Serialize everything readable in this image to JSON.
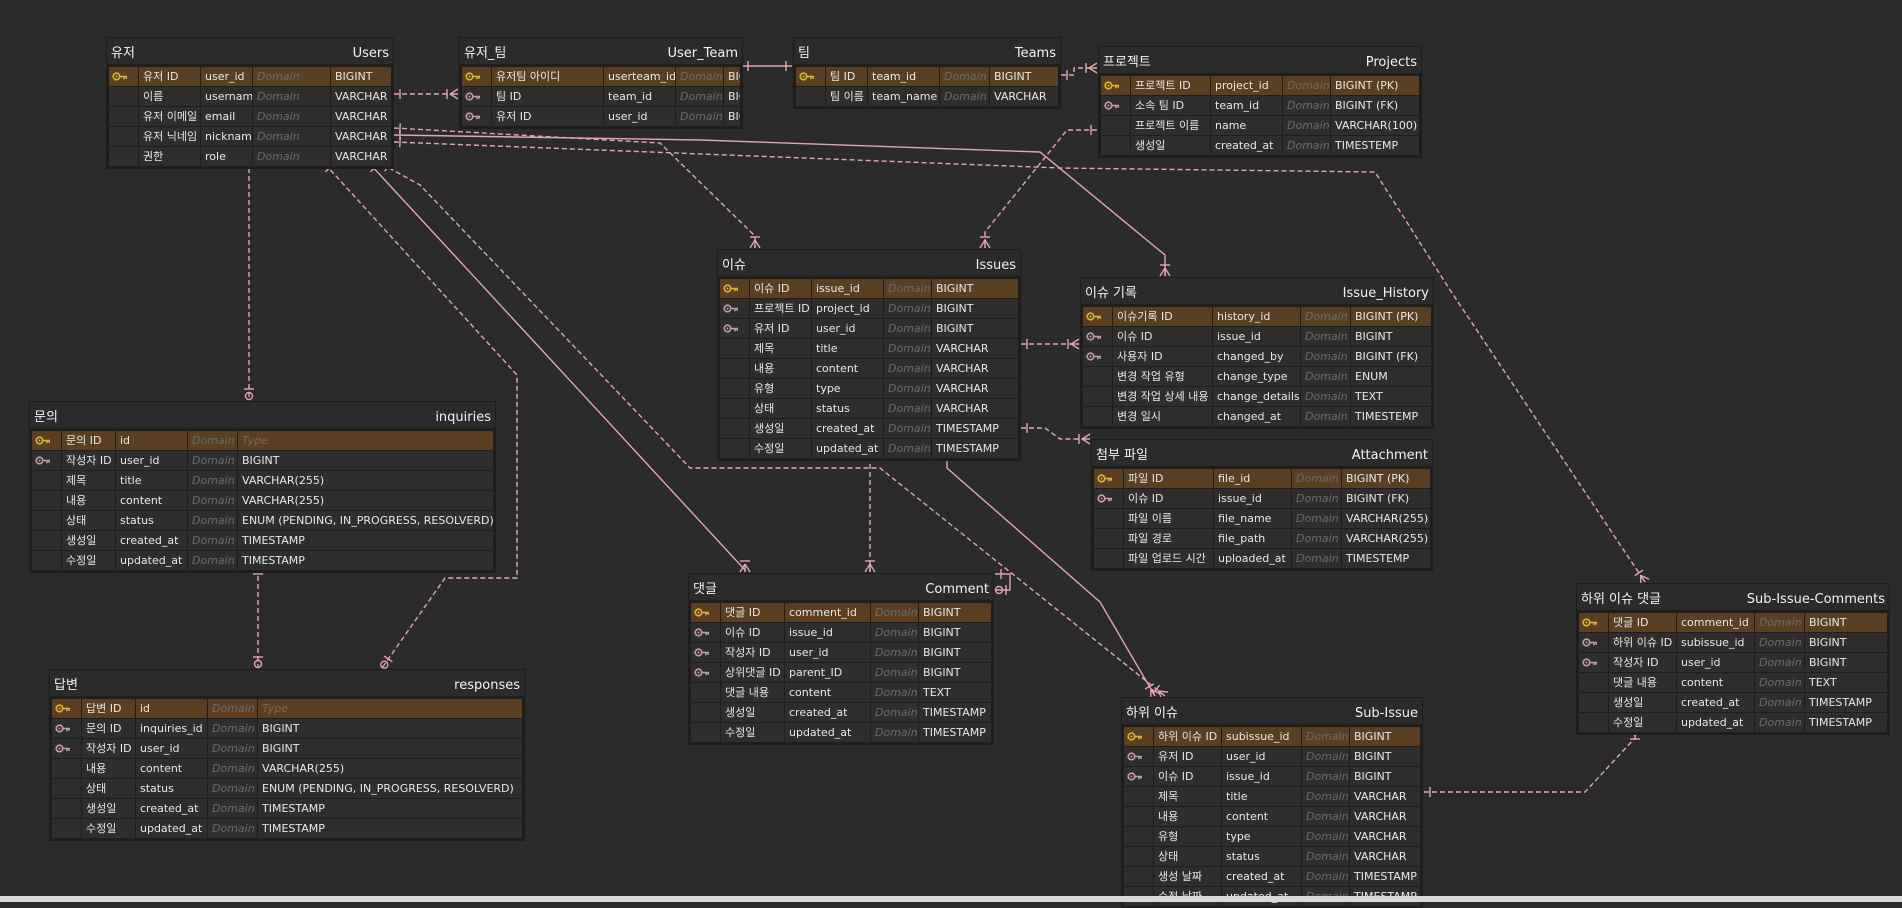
{
  "colors": {
    "background": "#2b2b2b",
    "row": "#2e2e2e",
    "pk_row": "#5a3f22",
    "link": "#e4a4b4",
    "pk_key": "#e0b437",
    "fk_key": "#c89aa6"
  },
  "domain_label": "Domain",
  "entities": [
    {
      "id": "users",
      "logical": "유저",
      "physical": "Users",
      "rows": [
        {
          "key": "pk",
          "name": "유저 ID",
          "column": "user_id",
          "type": "BIGINT"
        },
        {
          "key": "",
          "name": "이름",
          "column": "username",
          "type": "VARCHAR"
        },
        {
          "key": "",
          "name": "유저 이메일",
          "column": "email",
          "type": "VARCHAR"
        },
        {
          "key": "",
          "name": "유저 닉네임",
          "column": "nickname",
          "type": "VARCHAR"
        },
        {
          "key": "",
          "name": "권한",
          "column": " role",
          "type": "VARCHAR"
        }
      ]
    },
    {
      "id": "user_team",
      "logical": "유저_팀",
      "physical": "User_Team",
      "rows": [
        {
          "key": "pk",
          "name": "유저팀 아이디",
          "column": "userteam_id",
          "type": "BIGINT"
        },
        {
          "key": "fk",
          "name": "팀 ID",
          "column": "team_id",
          "type": "BIGINT"
        },
        {
          "key": "fk",
          "name": "유저 ID",
          "column": "user_id",
          "type": "BIGINT"
        }
      ]
    },
    {
      "id": "teams",
      "logical": "팀",
      "physical": "Teams",
      "rows": [
        {
          "key": "pk",
          "name": "팀 ID",
          "column": "team_id",
          "type": "BIGINT"
        },
        {
          "key": "",
          "name": "팀 이름",
          "column": "team_name",
          "type": "VARCHAR"
        }
      ]
    },
    {
      "id": "projects",
      "logical": "프로젝트",
      "physical": "Projects",
      "rows": [
        {
          "key": "pk",
          "name": "프로젝트 ID",
          "column": "project_id",
          "type": "BIGINT (PK)"
        },
        {
          "key": "fk",
          "name": "소속 팀 ID",
          "column": "team_id",
          "type": "BIGINT (FK)"
        },
        {
          "key": "",
          "name": "프로젝트 이름",
          "column": "name",
          "type": "VARCHAR(100)"
        },
        {
          "key": "",
          "name": "생성일",
          "column": "created_at",
          "type": "TIMESTEMP"
        }
      ]
    },
    {
      "id": "issues",
      "logical": "이슈",
      "physical": "Issues",
      "rows": [
        {
          "key": "pk",
          "name": "이슈 ID",
          "column": "issue_id",
          "type": "BIGINT"
        },
        {
          "key": "fk",
          "name": "프로젝트 ID",
          "column": "project_id",
          "type": "BIGINT"
        },
        {
          "key": "fk",
          "name": "유저 ID",
          "column": "user_id",
          "type": "BIGINT"
        },
        {
          "key": "",
          "name": "제목",
          "column": "title",
          "type": "VARCHAR"
        },
        {
          "key": "",
          "name": "내용",
          "column": "content",
          "type": "VARCHAR"
        },
        {
          "key": "",
          "name": "유형",
          "column": "type",
          "type": "VARCHAR"
        },
        {
          "key": "",
          "name": "상태",
          "column": "status",
          "type": "VARCHAR"
        },
        {
          "key": "",
          "name": "생성일",
          "column": "created_at",
          "type": "TIMESTAMP"
        },
        {
          "key": "",
          "name": "수정일",
          "column": "updated_at",
          "type": "TIMESTAMP"
        }
      ]
    },
    {
      "id": "issue_history",
      "logical": "이슈 기록",
      "physical": "Issue_History",
      "rows": [
        {
          "key": "pk",
          "name": "이슈기록 ID",
          "column": "history_id",
          "type": "BIGINT (PK)"
        },
        {
          "key": "fk",
          "name": "이슈 ID",
          "column": "issue_id",
          "type": "BIGINT"
        },
        {
          "key": "fk",
          "name": "사용자 ID",
          "column": "changed_by",
          "type": "BIGINT (FK)"
        },
        {
          "key": "",
          "name": "변경 작업 유형",
          "column": "change_type",
          "type": "ENUM"
        },
        {
          "key": "",
          "name": "변경 작업 상세 내용",
          "column": "change_details",
          "type": "TEXT"
        },
        {
          "key": "",
          "name": "변경 일시",
          "column": "changed_at",
          "type": "TIMESTEMP"
        }
      ]
    },
    {
      "id": "attachment",
      "logical": "첨부 파일",
      "physical": "Attachment",
      "rows": [
        {
          "key": "pk",
          "name": "파일 ID",
          "column": "file_id",
          "type": "BIGINT (PK)"
        },
        {
          "key": "fk",
          "name": "이슈 ID",
          "column": "issue_id",
          "type": "BIGINT (FK)"
        },
        {
          "key": "",
          "name": "파일 이름",
          "column": "file_name",
          "type": "VARCHAR(255)"
        },
        {
          "key": "",
          "name": "파일 경로",
          "column": "file_path",
          "type": "VARCHAR(255)"
        },
        {
          "key": "",
          "name": "파일 업로드 시간",
          "column": "uploaded_at",
          "type": "TIMESTEMP"
        }
      ]
    },
    {
      "id": "inquiries",
      "logical": "문의",
      "physical": "inquiries",
      "rows": [
        {
          "key": "pk",
          "name": "문의 ID",
          "column": "id",
          "type": "Type",
          "type_placeholder": true
        },
        {
          "key": "fk",
          "name": "작성자 ID",
          "column": "user_id",
          "type": "BIGINT"
        },
        {
          "key": "",
          "name": "제목",
          "column": "title",
          "type": "VARCHAR(255)"
        },
        {
          "key": "",
          "name": "내용",
          "column": "content",
          "type": "VARCHAR(255)"
        },
        {
          "key": "",
          "name": "상태",
          "column": "status",
          "type": "ENUM (PENDING, IN_PROGRESS, RESOLVERD)"
        },
        {
          "key": "",
          "name": "생성일",
          "column": "created_at",
          "type": "TIMESTAMP"
        },
        {
          "key": "",
          "name": "수정일",
          "column": "updated_at",
          "type": "TIMESTAMP"
        }
      ]
    },
    {
      "id": "responses",
      "logical": "답변",
      "physical": "responses",
      "rows": [
        {
          "key": "pk",
          "name": "답변 ID",
          "column": "id",
          "type": "Type",
          "type_placeholder": true
        },
        {
          "key": "fk",
          "name": "문의 ID",
          "column": "inquiries_id",
          "type": "BIGINT"
        },
        {
          "key": "fk",
          "name": "작성자 ID",
          "column": "user_id",
          "type": "BIGINT"
        },
        {
          "key": "",
          "name": "내용",
          "column": "content",
          "type": "VARCHAR(255)"
        },
        {
          "key": "",
          "name": "상태",
          "column": "status",
          "type": "ENUM (PENDING, IN_PROGRESS, RESOLVERD)"
        },
        {
          "key": "",
          "name": "생성일",
          "column": "created_at",
          "type": "TIMESTAMP"
        },
        {
          "key": "",
          "name": "수정일",
          "column": "updated_at",
          "type": "TIMESTAMP"
        }
      ]
    },
    {
      "id": "comment",
      "logical": "댓글",
      "physical": "Comment",
      "rows": [
        {
          "key": "pk",
          "name": "댓글 ID",
          "column": "comment_id",
          "type": "BIGINT"
        },
        {
          "key": "fk",
          "name": "이슈 ID",
          "column": "issue_id",
          "type": "BIGINT"
        },
        {
          "key": "fk",
          "name": "작성자 ID",
          "column": "user_id",
          "type": "BIGINT"
        },
        {
          "key": "fk",
          "name": "상위댓글 ID",
          "column": "parent_ID",
          "type": "BIGINT"
        },
        {
          "key": "",
          "name": "댓글 내용",
          "column": "content",
          "type": "TEXT"
        },
        {
          "key": "",
          "name": "생성일",
          "column": "created_at",
          "type": "TIMESTAMP"
        },
        {
          "key": "",
          "name": "수정일",
          "column": "updated_at",
          "type": "TIMESTAMP"
        }
      ]
    },
    {
      "id": "sub_issue",
      "logical": "하위 이슈",
      "physical": "Sub-Issue",
      "rows": [
        {
          "key": "pk",
          "name": "하위 이슈 ID",
          "column": "subissue_id",
          "type": "BIGINT"
        },
        {
          "key": "fk",
          "name": "유저 ID",
          "column": "user_id",
          "type": "BIGINT"
        },
        {
          "key": "fk",
          "name": "이슈 ID",
          "column": "issue_id",
          "type": "BIGINT"
        },
        {
          "key": "",
          "name": "제목",
          "column": "title",
          "type": "VARCHAR"
        },
        {
          "key": "",
          "name": "내용",
          "column": "content",
          "type": "VARCHAR"
        },
        {
          "key": "",
          "name": "유형",
          "column": "type",
          "type": "VARCHAR"
        },
        {
          "key": "",
          "name": "상태",
          "column": "status",
          "type": "VARCHAR"
        },
        {
          "key": "",
          "name": "생성 날짜",
          "column": "created_at",
          "type": "TIMESTAMP"
        },
        {
          "key": "",
          "name": "수정 날짜",
          "column": "updated_at",
          "type": "TIMESTAMP"
        }
      ]
    },
    {
      "id": "sub_issue_comments",
      "logical": "하위 이슈 댓글",
      "physical": "Sub-Issue-Comments",
      "rows": [
        {
          "key": "pk",
          "name": "댓글 ID",
          "column": "comment_id",
          "type": "BIGINT"
        },
        {
          "key": "fk",
          "name": "하위 이슈 ID",
          "column": "subissue_id",
          "type": "BIGINT"
        },
        {
          "key": "fk",
          "name": "작성자 ID",
          "column": "user_id",
          "type": "BIGINT"
        },
        {
          "key": "",
          "name": "댓글 내용",
          "column": "content",
          "type": "TEXT"
        },
        {
          "key": "",
          "name": "생성일",
          "column": "created_at",
          "type": "TIMESTAMP"
        },
        {
          "key": "",
          "name": "수정일",
          "column": "updated_at",
          "type": "TIMESTAMP"
        }
      ]
    }
  ],
  "relationships": [
    {
      "from": "users",
      "to": "user_team",
      "style": "dashed"
    },
    {
      "from": "user_team",
      "to": "teams",
      "style": "solid"
    },
    {
      "from": "teams",
      "to": "projects",
      "style": "dashed"
    },
    {
      "from": "users",
      "to": "issues",
      "style": "dashed"
    },
    {
      "from": "projects",
      "to": "issues",
      "style": "dashed"
    },
    {
      "from": "users",
      "to": "issue_history",
      "style": "solid"
    },
    {
      "from": "issues",
      "to": "issue_history",
      "style": "dashed"
    },
    {
      "from": "issues",
      "to": "attachment",
      "style": "dashed"
    },
    {
      "from": "users",
      "to": "inquiries",
      "style": "dashed"
    },
    {
      "from": "inquiries",
      "to": "responses",
      "style": "dashed"
    },
    {
      "from": "users",
      "to": "responses",
      "style": "dashed"
    },
    {
      "from": "users",
      "to": "comment",
      "style": "solid"
    },
    {
      "from": "issues",
      "to": "comment",
      "style": "dashed"
    },
    {
      "from": "comment",
      "to": "comment",
      "style": "solid"
    },
    {
      "from": "users",
      "to": "sub_issue",
      "style": "dashed"
    },
    {
      "from": "issues",
      "to": "sub_issue",
      "style": "solid"
    },
    {
      "from": "users",
      "to": "sub_issue_comments",
      "style": "dashed"
    },
    {
      "from": "sub_issue",
      "to": "sub_issue_comments",
      "style": "dashed"
    }
  ]
}
